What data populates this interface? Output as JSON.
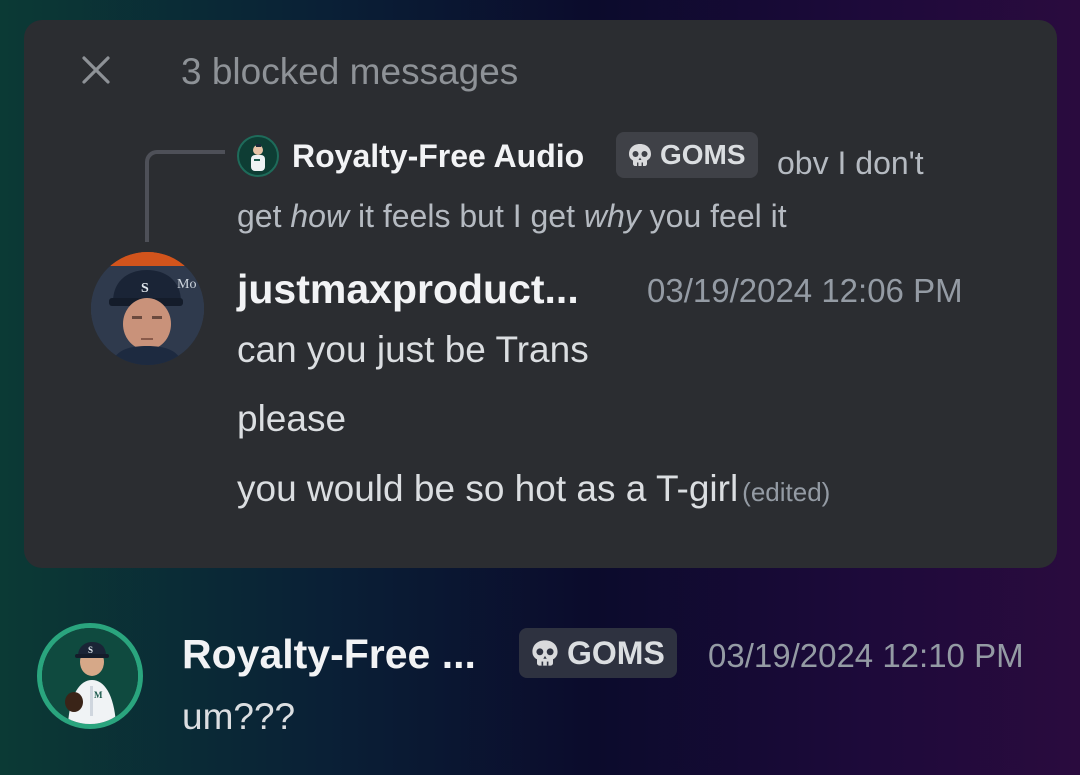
{
  "blocked": {
    "title": "3 blocked messages",
    "close_icon": "close-icon"
  },
  "reply": {
    "author": "Royalty-Free Audio",
    "tag_label": "GOMS",
    "tag_icon": "skull-icon",
    "text_part1": "obv I don't get ",
    "text_em1": "how",
    "text_part2": " it feels but I get ",
    "text_em2": "why",
    "text_part3": " you feel it"
  },
  "message1": {
    "author": "justmaxproduct...",
    "timestamp": "03/19/2024 12:06 PM",
    "lines": [
      "can you just be Trans",
      "please",
      "you would be so hot as a T-girl"
    ],
    "edited_label": "(edited)"
  },
  "message2": {
    "author": "Royalty-Free ...",
    "tag_label": "GOMS",
    "tag_icon": "skull-icon",
    "timestamp": "03/19/2024 12:10 PM",
    "text": "um???"
  },
  "colors": {
    "panel_bg": "#2b2d31",
    "tag_bg": "#3f4147",
    "avatar_ring": "#2aa57e"
  }
}
